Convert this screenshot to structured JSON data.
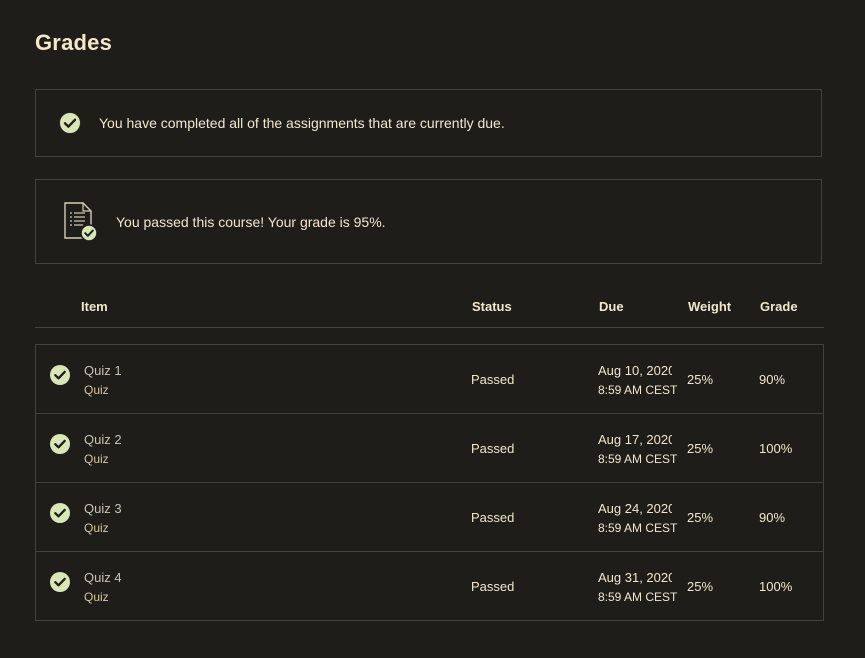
{
  "page": {
    "title": "Grades"
  },
  "banners": {
    "completed_text": "You have completed all of the assignments that are currently due.",
    "passed_text": "You passed this course! Your grade is 95%."
  },
  "table": {
    "headers": {
      "item": "Item",
      "status": "Status",
      "due": "Due",
      "weight": "Weight",
      "grade": "Grade"
    },
    "rows": [
      {
        "name": "Quiz 1",
        "type": "Quiz",
        "status": "Passed",
        "due_date": "Aug 10, 2020",
        "due_time": "8:59 AM CEST",
        "weight": "25%",
        "grade": "90%"
      },
      {
        "name": "Quiz 2",
        "type": "Quiz",
        "status": "Passed",
        "due_date": "Aug 17, 2020",
        "due_time": "8:59 AM CEST",
        "weight": "25%",
        "grade": "100%"
      },
      {
        "name": "Quiz 3",
        "type": "Quiz",
        "status": "Passed",
        "due_date": "Aug 24, 2020",
        "due_time": "8:59 AM CEST",
        "weight": "25%",
        "grade": "90%"
      },
      {
        "name": "Quiz 4",
        "type": "Quiz",
        "status": "Passed",
        "due_date": "Aug 31, 2020",
        "due_time": "8:59 AM CEST",
        "weight": "25%",
        "grade": "100%"
      }
    ]
  },
  "icons": {
    "completed": "check-circle-icon",
    "passed": "document-check-icon",
    "row_status": "check-circle-icon"
  },
  "colors": {
    "background": "#1f1d1a",
    "text": "#f2e6cc",
    "check_fill": "#d8e6b8",
    "check_mark": "#1f1d1a",
    "border": "#45423c"
  }
}
